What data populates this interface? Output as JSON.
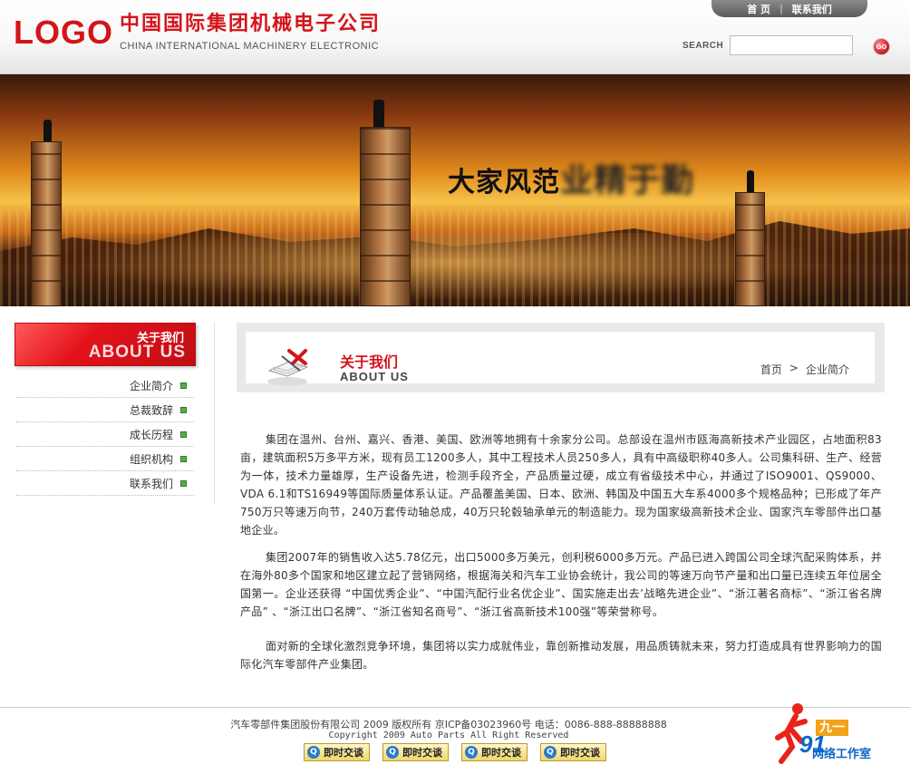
{
  "header": {
    "logo": "LOGO",
    "company_cn": "中国国际集团机械电子公司",
    "company_en": "CHINA INTERNATIONAL MACHINERY ELECTRONIC",
    "nav": [
      "首 页",
      "联系我们"
    ],
    "search_label": "SEARCH",
    "search_value": "",
    "go_label": "GO"
  },
  "banner": {
    "slogan_clear": "大家风范",
    "slogan_blur": "业精于勤"
  },
  "sidebar": {
    "title_cn": "关于我们",
    "title_en": "ABOUT US",
    "items": [
      "企业简介",
      "总裁致辞",
      "成长历程",
      "组织机构",
      "联系我们"
    ]
  },
  "content": {
    "title_cn": "关于我们",
    "title_en": "ABOUT US",
    "breadcrumb": [
      "首页",
      ">",
      "企业简介"
    ],
    "paragraphs": [
      "集团在温州、台州、嘉兴、香港、美国、欧洲等地拥有十余家分公司。总部设在温州市瓯海高新技术产业园区，占地面积83亩，建筑面积5万多平方米，现有员工1200多人，其中工程技术人员250多人，具有中高级职称40多人。公司集科研、生产、经营为一体，技术力量雄厚，生产设备先进，检测手段齐全，产品质量过硬，成立有省级技术中心，并通过了ISO9001、QS9000、VDA 6.1和TS16949等国际质量体系认证。产品覆盖美国、日本、欧洲、韩国及中国五大车系4000多个规格品种；已形成了年产750万只等速万向节，240万套传动轴总成，40万只轮毂轴承单元的制造能力。现为国家级高新技术企业、国家汽车零部件出口基地企业。",
      "集团2007年的销售收入达5.78亿元，出口5000多万美元，创利税6000多万元。产品已进入跨国公司全球汽配采购体系，并在海外80多个国家和地区建立起了营销网络，根据海关和汽车工业协会统计，我公司的等速万向节产量和出口量已连续五年位居全国第一。企业还获得 “中国优秀企业”、“中国汽配行业名优企业”、国实施走出去’战略先进企业”、“浙江著名商标”、“浙江省名牌产品” 、“浙江出口名牌”、“浙江省知名商号”、“浙江省高新技术100强”等荣誉称号。",
      "面对新的全球化激烈竞争环境，集团将以实力成就伟业，靠创新推动发展，用品质铸就未来，努力打造成具有世界影响力的国际化汽车零部件产业集团。"
    ]
  },
  "footer": {
    "line1": "汽车零部件集团股份有限公司 2009 版权所有 京ICP备03023960号 电话：0086-888-88888888",
    "line2": "Copyright 2009 Auto Parts All Right Reserved",
    "qq_buttons": [
      "即时交谈",
      "即时交谈",
      "即时交谈",
      "即时交谈"
    ]
  },
  "studio": {
    "number": "91",
    "tag": "九一",
    "subtitle": "网络工作室"
  },
  "colors": {
    "brand_red": "#d4141a",
    "bullet_green": "#5aaa4a",
    "studio_blue": "#0b66c8"
  }
}
